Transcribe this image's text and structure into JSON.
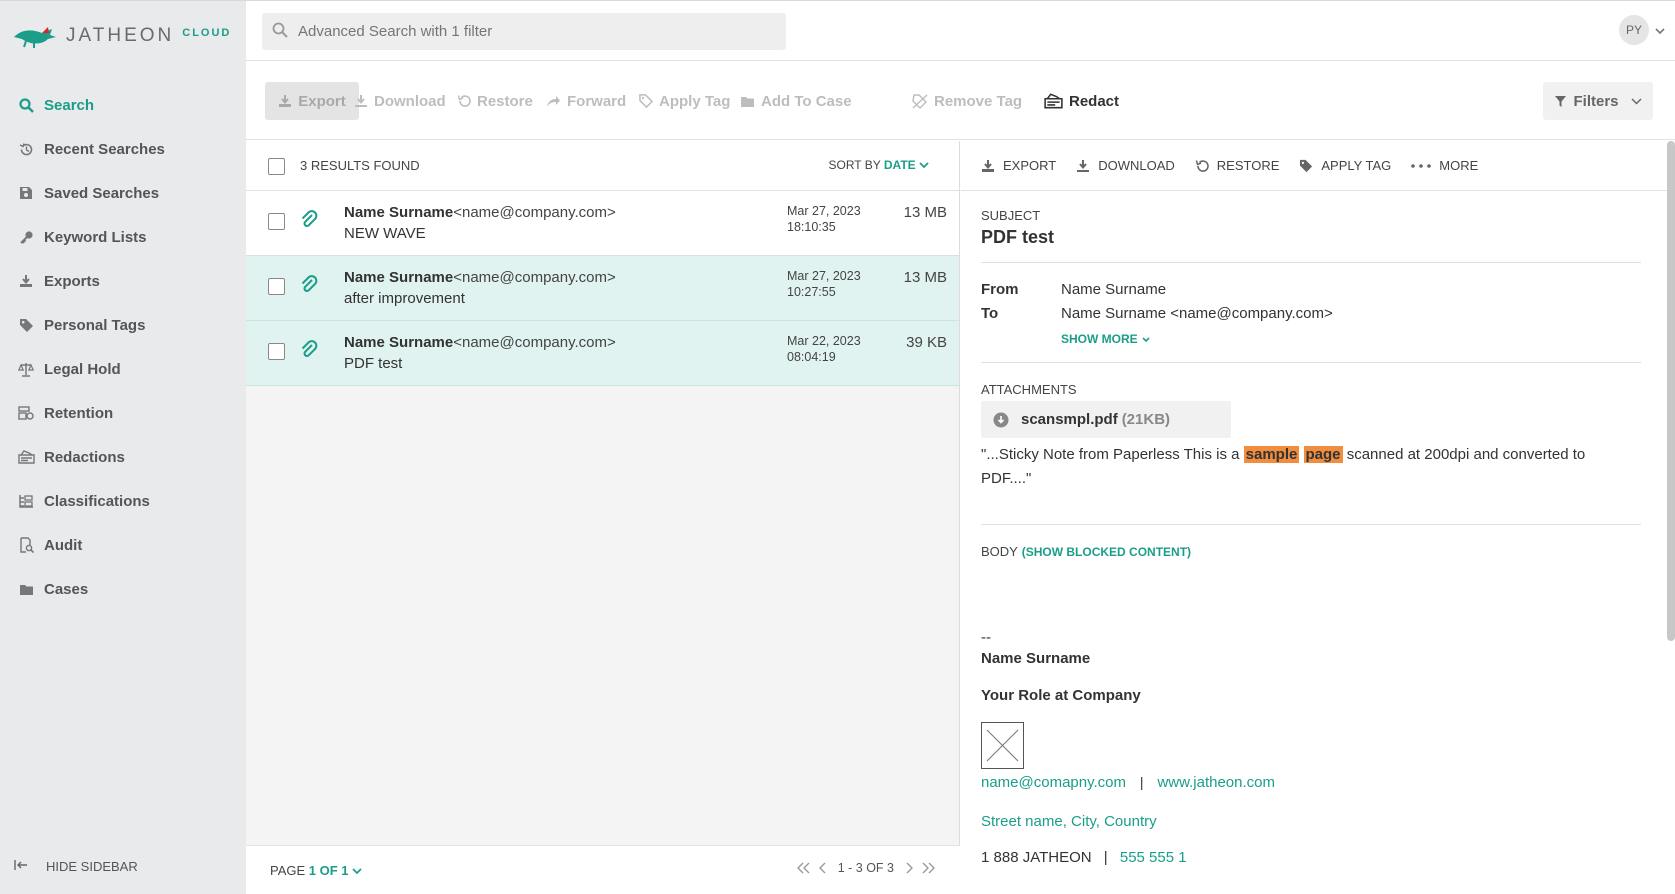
{
  "logo": {
    "name": "JATHEON",
    "sub": "CLOUD"
  },
  "search": {
    "placeholder": "Advanced Search with 1 filter"
  },
  "user": {
    "initials": "PY"
  },
  "sidebar": {
    "items": [
      {
        "label": "Search",
        "icon": "search-icon"
      },
      {
        "label": "Recent Searches",
        "icon": "history-icon"
      },
      {
        "label": "Saved Searches",
        "icon": "floppy-icon"
      },
      {
        "label": "Keyword Lists",
        "icon": "key-icon"
      },
      {
        "label": "Exports",
        "icon": "download-icon"
      },
      {
        "label": "Personal Tags",
        "icon": "tag-icon"
      },
      {
        "label": "Legal Hold",
        "icon": "scale-icon"
      },
      {
        "label": "Retention",
        "icon": "retention-icon"
      },
      {
        "label": "Redactions",
        "icon": "redact-icon"
      },
      {
        "label": "Classifications",
        "icon": "classification-icon"
      },
      {
        "label": "Audit",
        "icon": "audit-icon"
      },
      {
        "label": "Cases",
        "icon": "folder-icon"
      }
    ],
    "hide_label": "HIDE SIDEBAR"
  },
  "toolbar": {
    "export": "Export",
    "download": "Download",
    "restore": "Restore",
    "forward": "Forward",
    "apply_tag": "Apply Tag",
    "add_to_case": "Add To Case",
    "remove_tag": "Remove Tag",
    "redact": "Redact",
    "filters": "Filters"
  },
  "list": {
    "results": "3 RESULTS FOUND",
    "sort_prefix": "SORT BY",
    "sort_value": "DATE",
    "rows": [
      {
        "name": "Name Surname",
        "email": "<name@company.com>",
        "subject": "NEW WAVE",
        "date": "Mar 27, 2023",
        "time": "18:10:35",
        "size": "13 MB"
      },
      {
        "name": "Name Surname",
        "email": "<name@company.com>",
        "subject": "after improvement",
        "date": "Mar 27, 2023",
        "time": "10:27:55",
        "size": "13 MB"
      },
      {
        "name": "Name Surname",
        "email": "<name@company.com>",
        "subject": "PDF test",
        "date": "Mar 22, 2023",
        "time": "08:04:19",
        "size": "39 KB"
      }
    ],
    "page_label": "PAGE",
    "page_value": "1 OF 1",
    "range": "1 - 3 OF 3"
  },
  "detail": {
    "bar": {
      "export": "EXPORT",
      "download": "DOWNLOAD",
      "restore": "RESTORE",
      "apply_tag": "APPLY TAG",
      "more": "MORE"
    },
    "subject_label": "SUBJECT",
    "subject": "PDF test",
    "from_label": "From",
    "from": "Name Surname",
    "to_label": "To",
    "to": "Name Surname <name@company.com>",
    "show_more": "SHOW MORE",
    "attachments_label": "ATTACHMENTS",
    "attachment_name": "scansmpl.pdf",
    "attachment_size": "(21KB)",
    "snippet_pre": "\"...Sticky Note from Paperless This is a",
    "hl1": "sample",
    "hl2": "page",
    "snippet_post": "scanned at 200dpi and converted to",
    "snippet_end": "PDF....\"",
    "body_label": "BODY",
    "body_blocked": "(SHOW BLOCKED CONTENT)",
    "sig_dash": "--",
    "sig_name": "Name Surname",
    "sig_role": "Your Role at Company",
    "sig_email": "name@comapny.com",
    "sig_sep": "|",
    "sig_web": "www.jatheon.com",
    "sig_address": "Street name, City, Country",
    "sig_phone": "1 888 JATHEON",
    "sig_phone2": "555 555 1"
  },
  "colors": {
    "accent": "#1a9e8a",
    "highlight": "#f08d3e",
    "sidebar": "#e8eaeb",
    "selected_row": "#e0f3f0"
  }
}
